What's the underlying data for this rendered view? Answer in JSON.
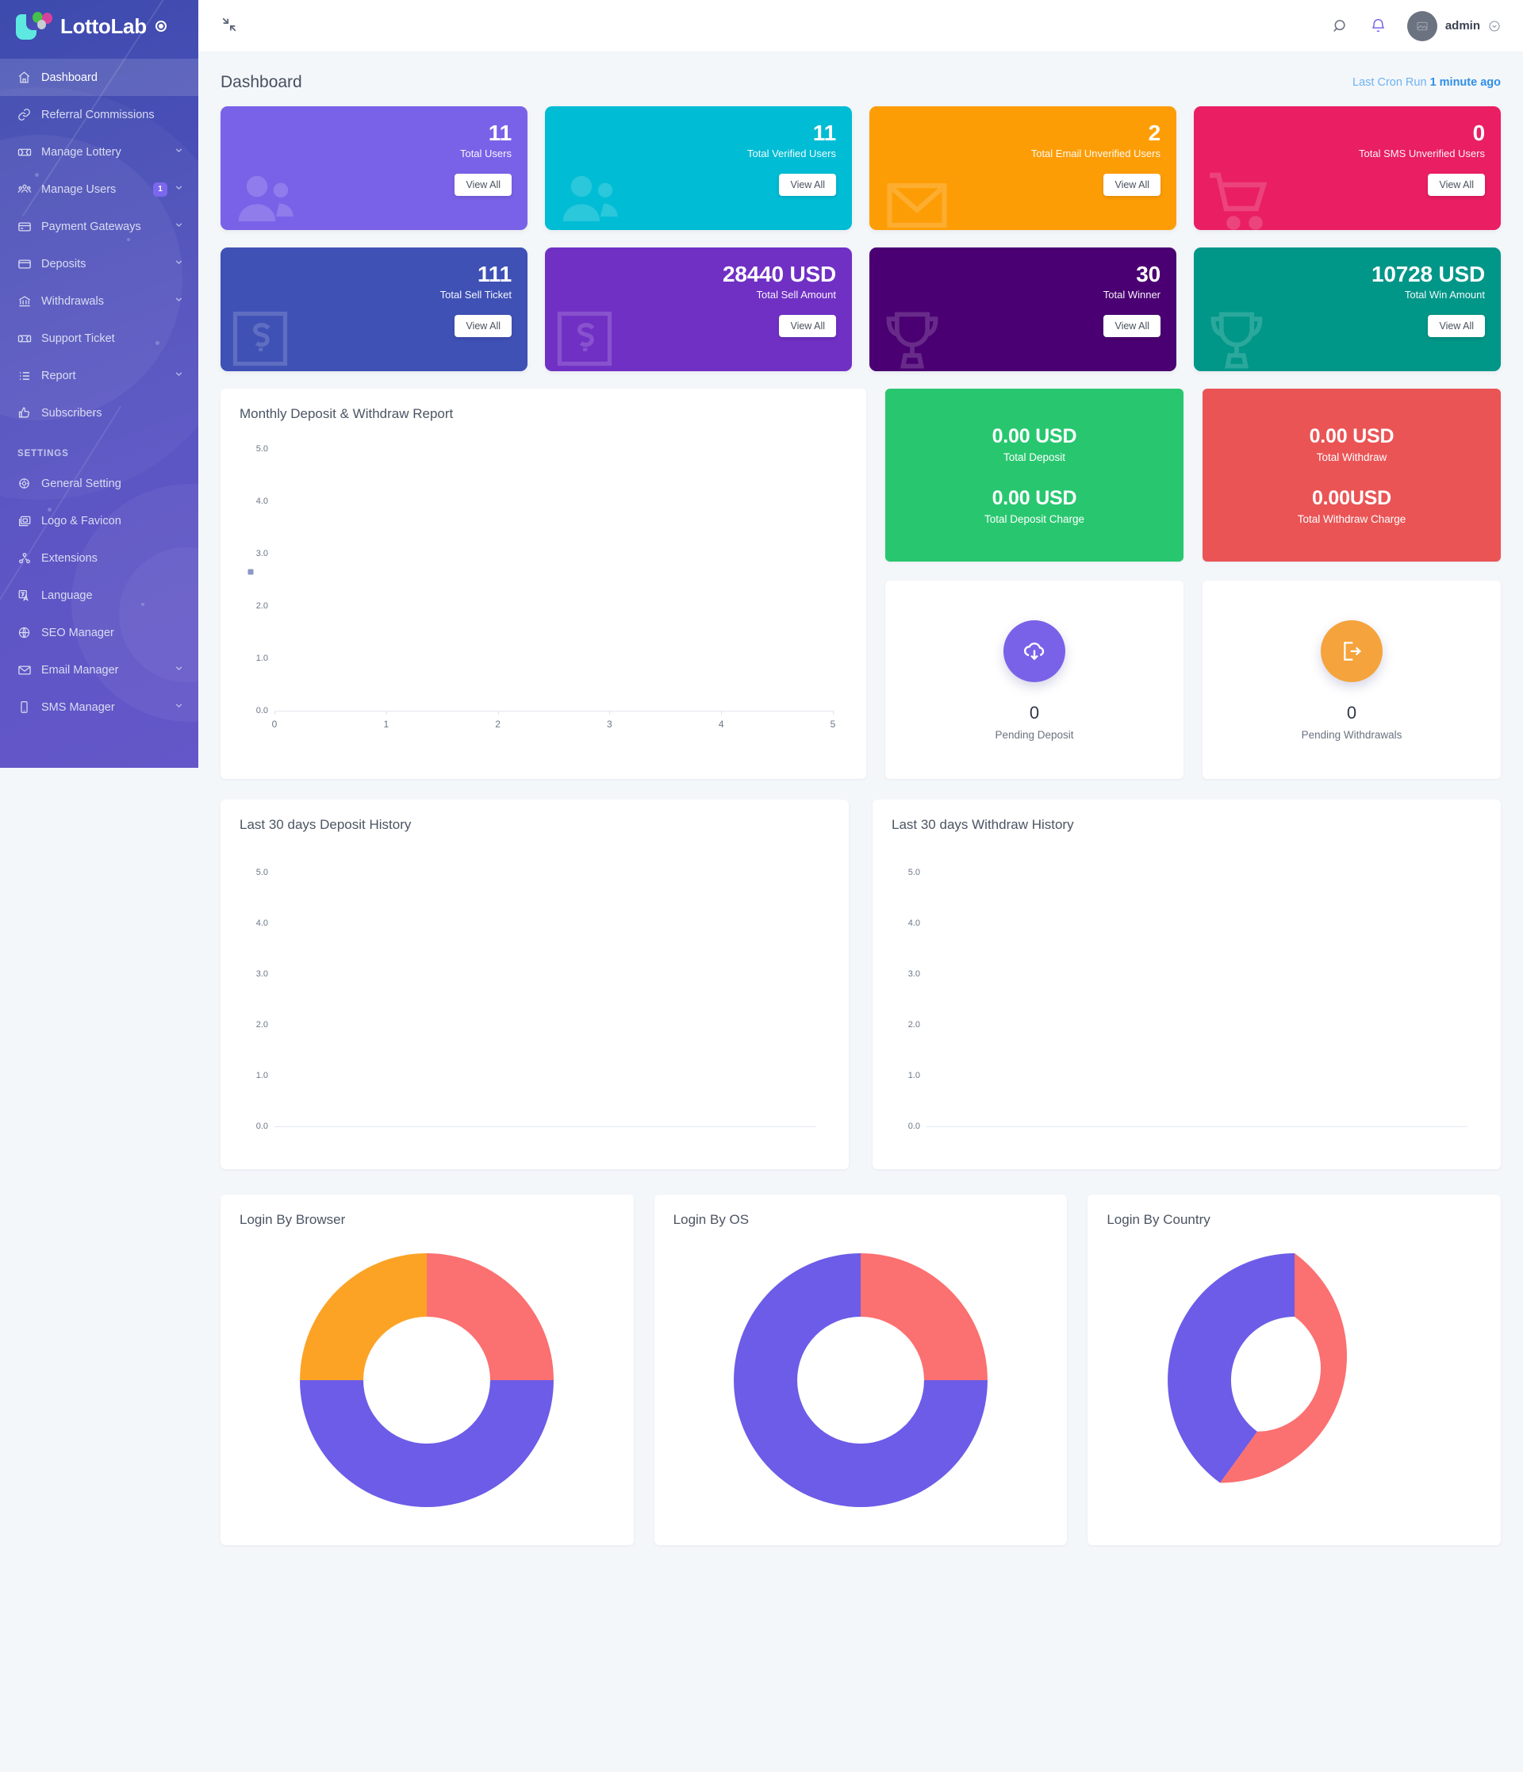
{
  "brand": {
    "name": "LottoLab"
  },
  "sidebar": {
    "items": [
      {
        "label": "Dashboard",
        "icon": "home-icon",
        "active": true,
        "caret": false,
        "badge": null
      },
      {
        "label": "Referral Commissions",
        "icon": "link-icon",
        "active": false,
        "caret": false,
        "badge": null
      },
      {
        "label": "Manage Lottery",
        "icon": "ticket-icon",
        "active": false,
        "caret": true,
        "badge": null
      },
      {
        "label": "Manage Users",
        "icon": "users-group-icon",
        "active": false,
        "caret": true,
        "badge": "1"
      },
      {
        "label": "Payment Gateways",
        "icon": "card-icon",
        "active": false,
        "caret": true,
        "badge": null
      },
      {
        "label": "Deposits",
        "icon": "wallet-icon",
        "active": false,
        "caret": true,
        "badge": null
      },
      {
        "label": "Withdrawals",
        "icon": "bank-icon",
        "active": false,
        "caret": true,
        "badge": null
      },
      {
        "label": "Support Ticket",
        "icon": "ticket-icon",
        "active": false,
        "caret": false,
        "badge": null
      },
      {
        "label": "Report",
        "icon": "list-icon",
        "active": false,
        "caret": true,
        "badge": null
      },
      {
        "label": "Subscribers",
        "icon": "thumbs-up-icon",
        "active": false,
        "caret": false,
        "badge": null
      }
    ],
    "section_label": "SETTINGS",
    "settings_items": [
      {
        "label": "General Setting",
        "icon": "gear-icon",
        "caret": false
      },
      {
        "label": "Logo & Favicon",
        "icon": "images-icon",
        "caret": false
      },
      {
        "label": "Extensions",
        "icon": "extensions-icon",
        "caret": false
      },
      {
        "label": "Language",
        "icon": "language-icon",
        "caret": false
      },
      {
        "label": "SEO Manager",
        "icon": "globe-icon",
        "caret": false
      },
      {
        "label": "Email Manager",
        "icon": "envelope-icon",
        "caret": true
      },
      {
        "label": "SMS Manager",
        "icon": "mobile-icon",
        "caret": true
      }
    ]
  },
  "topbar": {
    "collapse_icon": "collapse-icon",
    "search_icon": "search-icon",
    "bell_icon": "bell-icon",
    "avatar_icon": "avatar-placeholder-icon",
    "user_name": "admin",
    "caret_icon": "chevron-down-icon"
  },
  "page": {
    "title": "Dashboard",
    "cron_prefix": "Last Cron Run",
    "cron_value": "1 minute ago"
  },
  "stats": [
    {
      "value": "11",
      "label": "Total Users",
      "button": "View All",
      "color": "#7a62e8",
      "bg_icon": "users-group-icon"
    },
    {
      "value": "11",
      "label": "Total Verified Users",
      "button": "View All",
      "color": "#00bcd4",
      "bg_icon": "users-group-icon"
    },
    {
      "value": "2",
      "label": "Total Email Unverified Users",
      "button": "View All",
      "color": "#fd9d06",
      "bg_icon": "envelope-icon"
    },
    {
      "value": "0",
      "label": "Total SMS Unverified Users",
      "button": "View All",
      "color": "#e91e63",
      "bg_icon": "cart-icon"
    },
    {
      "value": "111",
      "label": "Total Sell Ticket",
      "button": "View All",
      "color": "#3f51b5",
      "bg_icon": "sell-icon"
    },
    {
      "value": "28440 USD",
      "label": "Total Sell Amount",
      "button": "View All",
      "color": "#7030c4",
      "bg_icon": "sell-icon"
    },
    {
      "value": "30",
      "label": "Total Winner",
      "button": "View All",
      "color": "#4a0072",
      "bg_icon": "trophy-icon"
    },
    {
      "value": "10728 USD",
      "label": "Total Win Amount",
      "button": "View All",
      "color": "#009688",
      "bg_icon": "trophy-icon"
    }
  ],
  "money_cards": [
    {
      "color": "#28c76f",
      "primary_value": "0.00 USD",
      "primary_label": "Total Deposit",
      "secondary_value": "0.00 USD",
      "secondary_label": "Total Deposit Charge"
    },
    {
      "color": "#ea5455",
      "primary_value": "0.00 USD",
      "primary_label": "Total Withdraw",
      "secondary_value": "0.00USD",
      "secondary_label": "Total Withdraw Charge"
    }
  ],
  "pending_cards": [
    {
      "value": "0",
      "label": "Pending Deposit",
      "color": "#7a62e8",
      "icon": "cloud-download-icon"
    },
    {
      "value": "0",
      "label": "Pending Withdrawals",
      "color": "#f5a33c",
      "icon": "logout-arrow-icon"
    }
  ],
  "chart_data": [
    {
      "type": "line",
      "title": "Monthly Deposit & Withdraw Report",
      "series": [],
      "x": [
        0,
        1,
        2,
        3,
        4,
        5
      ],
      "xtick_labels": [
        "0",
        "1",
        "2",
        "3",
        "4",
        "5"
      ],
      "ytick_labels": [
        "0.0",
        "1.0",
        "2.0",
        "3.0",
        "4.0",
        "5.0"
      ],
      "xlabel": "",
      "ylabel": "",
      "xlim": [
        0,
        5
      ],
      "ylim": [
        0,
        5
      ],
      "grid": false,
      "legend": "none",
      "note": "empty plot - no data series rendered"
    },
    {
      "type": "line",
      "title": "Last 30 days Deposit History",
      "series": [],
      "xtick_labels": [],
      "ytick_labels": [
        "0.0",
        "1.0",
        "2.0",
        "3.0",
        "4.0",
        "5.0"
      ],
      "xlabel": "",
      "ylabel": "",
      "ylim": [
        0,
        5
      ],
      "grid": false,
      "legend": "none",
      "note": "empty plot - no data series rendered"
    },
    {
      "type": "line",
      "title": "Last 30 days Withdraw History",
      "series": [],
      "xtick_labels": [],
      "ytick_labels": [
        "0.0",
        "1.0",
        "2.0",
        "3.0",
        "4.0",
        "5.0"
      ],
      "xlabel": "",
      "ylabel": "",
      "ylim": [
        0,
        5
      ],
      "grid": false,
      "legend": "none",
      "note": "empty plot - no data series rendered"
    },
    {
      "type": "pie",
      "title": "Login By Browser",
      "values": [
        25,
        50,
        25
      ],
      "colors": [
        "#fb7070",
        "#6c5ce7",
        "#fca326"
      ],
      "donut": true,
      "legend": "none"
    },
    {
      "type": "pie",
      "title": "Login By OS",
      "values": [
        25,
        75
      ],
      "colors": [
        "#fb7070",
        "#6c5ce7"
      ],
      "donut": true,
      "legend": "none"
    },
    {
      "type": "pie",
      "title": "Login By Country",
      "values": [
        60,
        40
      ],
      "colors": [
        "#fb7070",
        "#6c5ce7"
      ],
      "donut": true,
      "legend": "none"
    }
  ]
}
